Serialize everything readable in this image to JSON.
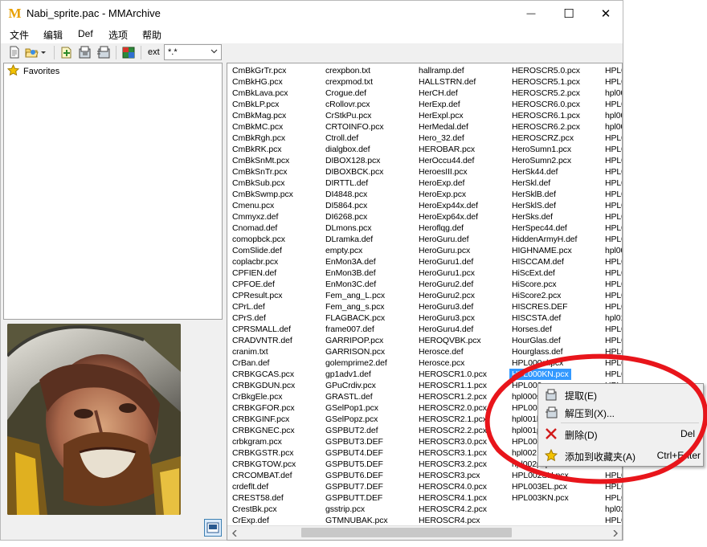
{
  "window": {
    "title": "Nabi_sprite.pac - MMArchive",
    "app_icon_letter": "M",
    "minimize_glyph": "—",
    "maximize_glyph": "☐",
    "close_glyph": "✕"
  },
  "menu": [
    {
      "label": "文件"
    },
    {
      "label": "编辑"
    },
    {
      "label": "Def"
    },
    {
      "label": "选项"
    },
    {
      "label": "帮助"
    }
  ],
  "toolbar": {
    "ext_label": "ext",
    "ext_value": "*.*",
    "icons": [
      "new-file-icon",
      "open-folder-icon",
      "dropdown-arrow-icon",
      "add-file-icon",
      "extract-icon",
      "extract-all-icon",
      "save-icon",
      "archive-icon"
    ]
  },
  "favorites": {
    "label": "Favorites",
    "icon": "star-icon"
  },
  "file_columns": [
    [
      "CmBkGrTr.pcx",
      "CmBkHG.pcx",
      "CmBkLava.pcx",
      "CmBkLP.pcx",
      "CmBkMag.pcx",
      "CmBkMC.pcx",
      "CmBkRgh.pcx",
      "CmBkRK.pcx",
      "CmBkSnMt.pcx",
      "CmBkSnTr.pcx",
      "CmBkSub.pcx",
      "CmBkSwmp.pcx",
      "Cmenu.pcx",
      "Cmmyxz.def",
      "Cnomad.def",
      "comopbck.pcx",
      "ComSlide.def",
      "coplacbr.pcx",
      "CPFIEN.def",
      "CPFOE.def",
      "CPResult.pcx",
      "CPrL.def",
      "CPrS.def",
      "CPRSMALL.def",
      "CRADVNTR.def",
      "cranim.txt",
      "CrBan.def",
      "CRBKGCAS.pcx",
      "CRBKGDUN.pcx",
      "CrBkgEle.pcx",
      "CRBKGFOR.pcx",
      "CRBKGINF.pcx",
      "CRBKGNEC.pcx",
      "crbkgram.pcx",
      "CRBKGSTR.pcx",
      "CRBKGTOW.pcx",
      "CRCOMBAT.def",
      "crdeflt.def",
      "CREST58.def",
      "CrestBk.pcx",
      "CrExp.def"
    ],
    [
      "crexpbon.txt",
      "crexpmod.txt",
      "Crogue.def",
      "cRollovr.pcx",
      "CrStkPu.pcx",
      "CRTOINFO.pcx",
      "Ctroll.def",
      "dialgbox.def",
      "DIBOX128.pcx",
      "DIBOXBCK.pcx",
      "DIRTTL.def",
      "DI4848.pcx",
      "DI5864.pcx",
      "DI6268.pcx",
      "DLmons.pcx",
      "DLramka.def",
      "empty.pcx",
      "EnMon3A.def",
      "EnMon3B.def",
      "EnMon3C.def",
      "Fem_ang_L.pcx",
      "Fem_ang_s.pcx",
      "FLAGBACK.pcx",
      "frame007.def",
      "GARRIPOP.pcx",
      "GARRISON.pcx",
      "golemprime2.def",
      "gp1adv1.def",
      "GPuCrdiv.pcx",
      "GRASTL.def",
      "GSelPop1.pcx",
      "GSelPopz.pcx",
      "GSPBUT2.def",
      "GSPBUT3.DEF",
      "GSPBUT4.DEF",
      "GSPBUT5.DEF",
      "GSPBUT6.DEF",
      "GSPBUT7.DEF",
      "GSPBUTT.DEF",
      "gsstrip.pcx",
      "GTMNUBAK.pcx"
    ],
    [
      "hallramp.def",
      "HALLSTRN.def",
      "HerCH.def",
      "HerExp.def",
      "HerExpl.pcx",
      "HerMedal.def",
      "Hero_32.def",
      "HEROBAR.pcx",
      "HerOccu44.def",
      "HeroesIII.pcx",
      "HeroExp.def",
      "HeroExp.pcx",
      "HeroExp44x.def",
      "HeroExp64x.def",
      "Heroflqg.def",
      "HeroGuru.def",
      "HeroGuru.pcx",
      "HeroGuru1.def",
      "HeroGuru1.pcx",
      "HeroGuru2.def",
      "HeroGuru2.pcx",
      "HeroGuru3.def",
      "HeroGuru3.pcx",
      "HeroGuru4.def",
      "HEROQVBK.pcx",
      "Herosce.def",
      "Herosce.pcx",
      "HEROSCR1.0.pcx",
      "HEROSCR1.1.pcx",
      "HEROSCR1.2.pcx",
      "HEROSCR2.0.pcx",
      "HEROSCR2.1.pcx",
      "HEROSCR2.2.pcx",
      "HEROSCR3.0.pcx",
      "HEROSCR3.1.pcx",
      "HEROSCR3.2.pcx",
      "HEROSCR3.pcx",
      "HEROSCR4.0.pcx",
      "HEROSCR4.1.pcx",
      "HEROSCR4.2.pcx",
      "HEROSCR4.pcx"
    ],
    [
      "HEROSCR5.0.pcx",
      "HEROSCR5.1.pcx",
      "HEROSCR5.2.pcx",
      "HEROSCR6.0.pcx",
      "HEROSCR6.1.pcx",
      "HEROSCR6.2.pcx",
      "HEROSCRZ.pcx",
      "HeroSumn1.pcx",
      "HeroSumn2.pcx",
      "HerSk44.def",
      "HerSkl.def",
      "HerSklB.def",
      "HerSklS.def",
      "HerSks.def",
      "HerSpec44.def",
      "HiddenArmyH.def",
      "HIGHNAME.pcx",
      "HISCCAM.def",
      "HiScExt.def",
      "HiScore.pcx",
      "HiScore2.pcx",
      "HISCRES.DEF",
      "HISCSTA.def",
      "Horses.def",
      "HourGlas.def",
      "Hourglass.def",
      "HPL000el.pcx",
      "HPL000KN.pcx",
      "HPL000",
      "hpl000s",
      "HPL001",
      "hpl001k",
      "hpl001p",
      "HPL001",
      "hpl002",
      "hpl002pl.pcx",
      "HPL002SH.pcx",
      "HPL003EL.pcx",
      "HPL003KN.pcx"
    ],
    [
      "HPL0",
      "HPL0",
      "hpl00",
      "HPL0",
      "hpl00",
      "hpl00",
      "HPL0",
      "HPL0",
      "HPL0",
      "HPL0",
      "HPL0",
      "HPL0",
      "HPL0",
      "HPL0",
      "HPL0",
      "HPL0",
      "hpl00",
      "HPL0",
      "HPL0",
      "HPL0",
      "HPL0",
      "HPL0",
      "hpl01",
      "HPL0",
      "HPL0",
      "HPL0",
      "HPL0",
      "HPL0",
      "HPL0",
      "HPL0",
      "HPL0",
      "HPL0",
      "HPL0",
      "HPL0",
      "HPL0",
      "HPL0",
      "HPL0",
      "HPL0",
      "HPL0",
      "hpl02",
      "HPL0"
    ]
  ],
  "selected_item": {
    "column": 3,
    "row": 27
  },
  "context_menu": {
    "items": [
      {
        "label": "提取(E)",
        "icon": "extract-icon",
        "shortcut": ""
      },
      {
        "label": "解压到(X)...",
        "icon": "extract-to-icon",
        "shortcut": ""
      },
      {
        "label": "删除(D)",
        "icon": "delete-x-icon",
        "shortcut": "Del"
      },
      {
        "label": "添加到收藏夹(A)",
        "icon": "star-icon",
        "shortcut": "Ctrl+Enter"
      }
    ]
  },
  "colors": {
    "selection": "#3399ff",
    "annotation": "#e8151b",
    "star": "#f2c200",
    "delete": "#d11a1a"
  }
}
